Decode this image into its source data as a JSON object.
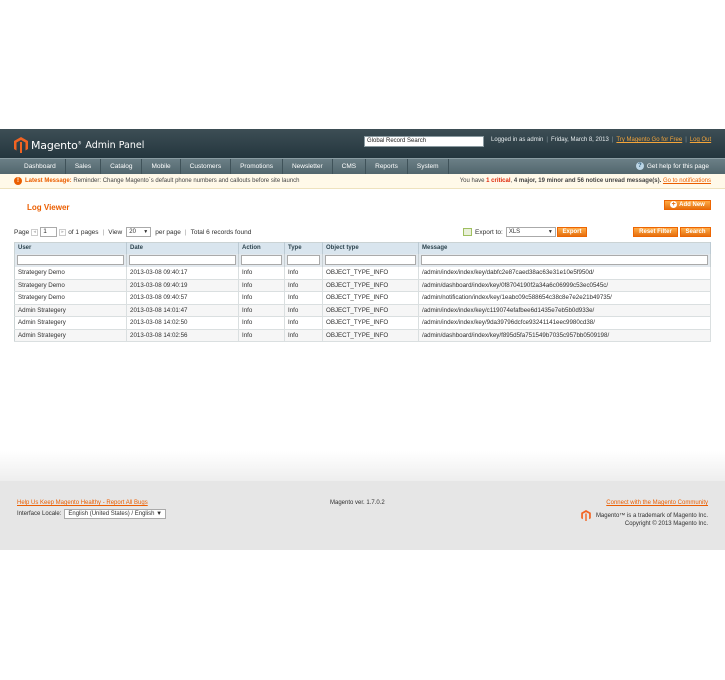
{
  "header": {
    "brand": "Magento",
    "brand_tm": "®",
    "panel": "Admin Panel",
    "search_value": "Global Record Search",
    "logged_in": "Logged in as admin",
    "date": "Friday, March 8, 2013",
    "try_link": "Try Magento Go for Free",
    "logout": "Log Out"
  },
  "nav": {
    "items": [
      "Dashboard",
      "Sales",
      "Catalog",
      "Mobile",
      "Customers",
      "Promotions",
      "Newsletter",
      "CMS",
      "Reports",
      "System"
    ],
    "help": "Get help for this page"
  },
  "notice": {
    "label": "Latest Message:",
    "text": "Reminder: Change Magento`s default phone numbers and callouts before site launch",
    "you_have": "You have",
    "critical_count": "1 critical",
    "major": "4 major,",
    "minor": "19 minor and",
    "notice_count": "56 notice unread message(s).",
    "go_link": "Go to notifications"
  },
  "page": {
    "title": "Log Viewer",
    "add_new": "Add New"
  },
  "pager": {
    "page_label": "Page",
    "page_value": "1",
    "of_pages": "of 1 pages",
    "view_label": "View",
    "view_value": "20",
    "per_page": "per page",
    "total": "Total 6 records found"
  },
  "export": {
    "label": "Export to:",
    "format": "XLS",
    "button": "Export"
  },
  "actions": {
    "reset": "Reset Filter",
    "search": "Search"
  },
  "grid": {
    "columns": [
      "User",
      "Date",
      "Action",
      "Type",
      "Object type",
      "Message"
    ],
    "rows": [
      [
        "Strategery Demo",
        "2013-03-08 09:40:17",
        "Info",
        "Info",
        "OBJECT_TYPE_INFO",
        "/admin/index/index/key/dabfc2e87caed38ac63e31e10e5f950d/"
      ],
      [
        "Strategery Demo",
        "2013-03-08 09:40:19",
        "Info",
        "Info",
        "OBJECT_TYPE_INFO",
        "/admin/dashboard/index/key/0f8704190f2a34a6c06999c53ec0545c/"
      ],
      [
        "Strategery Demo",
        "2013-03-08 09:40:57",
        "Info",
        "Info",
        "OBJECT_TYPE_INFO",
        "/admin/notification/index/key/1eabc09c588654c38c8e7e2e21b49735/"
      ],
      [
        "Admin Strategery",
        "2013-03-08 14:01:47",
        "Info",
        "Info",
        "OBJECT_TYPE_INFO",
        "/admin/index/index/key/c119074efafbee6d1435e7eb5b0d933e/"
      ],
      [
        "Admin Strategery",
        "2013-03-08 14:02:50",
        "Info",
        "Info",
        "OBJECT_TYPE_INFO",
        "/admin/index/index/key/9da39796dcfce93241141eec9980cd38/"
      ],
      [
        "Admin Strategery",
        "2013-03-08 14:02:56",
        "Info",
        "Info",
        "OBJECT_TYPE_INFO",
        "/admin/dashboard/index/key/f895d5fa751549b7035c957bb0509198/"
      ]
    ]
  },
  "footer": {
    "bugs": "Help Us Keep Magento Healthy - Report All Bugs",
    "locale_label": "Interface Locale:",
    "locale_value": "English (United States) / English",
    "version": "Magento ver. 1.7.0.2",
    "community": "Connect with the Magento Community",
    "trademark": "Magento™ is a trademark of Magento Inc.",
    "copyright": "Copyright © 2013 Magento Inc."
  },
  "colors": {
    "accent": "#eb5e00",
    "header_bg": "#2f3f46",
    "nav_bg": "#5e7279",
    "grid_header": "#d9e5ee"
  }
}
